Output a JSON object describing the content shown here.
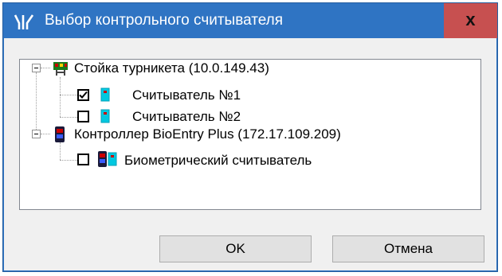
{
  "window": {
    "title": "Выбор контрольного считывателя",
    "close_label": "x"
  },
  "tree": {
    "nodes": [
      {
        "label": "Стойка турникета (10.0.149.43)",
        "icon": "turnstile-icon",
        "expanded": true,
        "children": [
          {
            "label": "Считыватель №1",
            "icon": "reader-icon",
            "checked": true
          },
          {
            "label": "Считыватель №2",
            "icon": "reader-icon",
            "checked": false
          }
        ]
      },
      {
        "label": "Контроллер BioEntry Plus (172.17.109.209)",
        "icon": "controller-icon",
        "expanded": true,
        "children": [
          {
            "label": "Биометрический считыватель",
            "icon": "biometric-reader-icon",
            "checked": false
          }
        ]
      }
    ]
  },
  "buttons": {
    "ok_label": "OK",
    "cancel_label": "Отмена"
  },
  "colors": {
    "titlebar": "#2f74c3",
    "close_button": "#c75050",
    "reader_icon": "#00c8e0"
  }
}
